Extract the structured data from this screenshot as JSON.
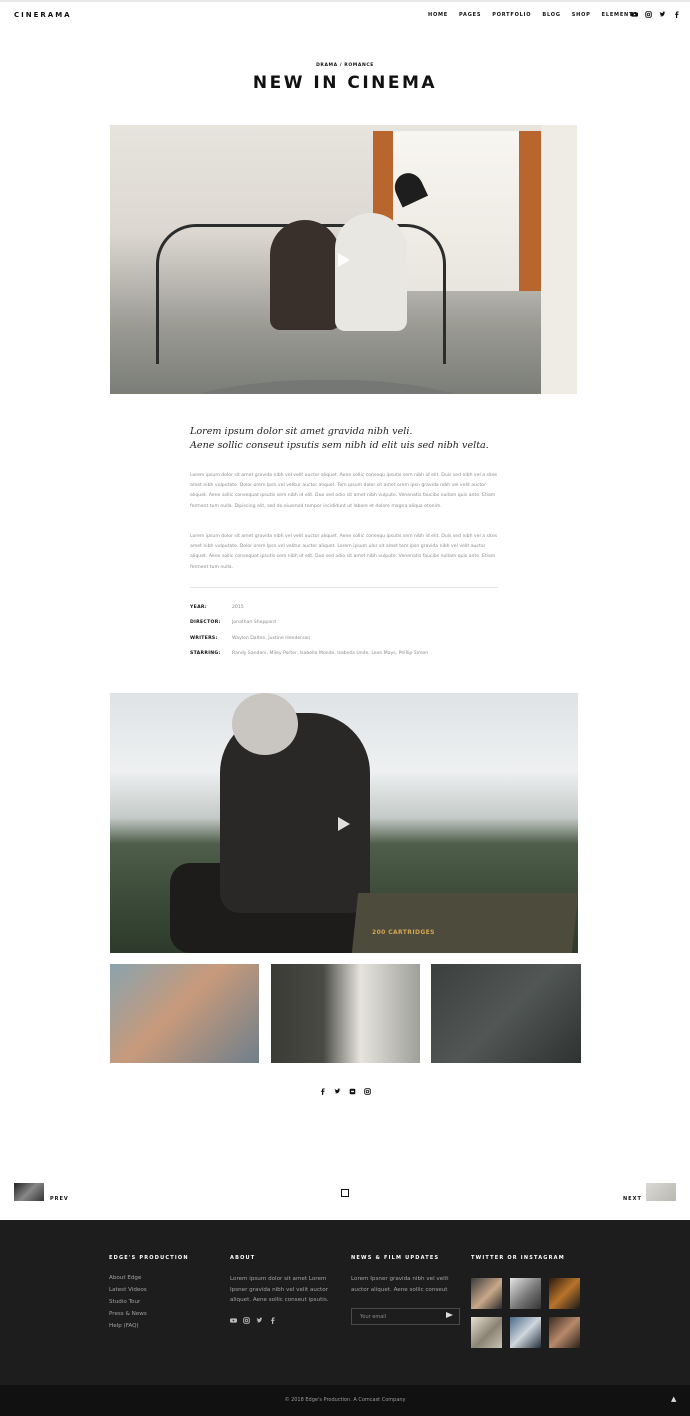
{
  "header": {
    "logo": "CINERAMA",
    "nav": [
      "HOME",
      "PAGES",
      "PORTFOLIO",
      "BLOG",
      "SHOP",
      "ELEMENTS"
    ],
    "social_icons": [
      "youtube-icon",
      "instagram-icon",
      "twitter-icon",
      "facebook-icon"
    ]
  },
  "article": {
    "category": "DRAMA / ROMANCE",
    "title": "NEW IN CINEMA",
    "lead_line1": "Lorem ipsum dolor sit amet gravida nibh veli.",
    "lead_line2": "Aene sollic conseut ipsutis sem nibh id elit uis sed nibh velta.",
    "paragraph1": "Lorem ipsum dolor sit amet gravida nibh vel velit auctor aliquet. Aene sollic consequ ipsutis sem nibh id elit. Duis sed nibh vel a sites amet nibh vulputate. Dolor orem Ipsn vel velitur auctor aliquet. Tem ipsum dolor sit amet orem ipsn gravida nibh vel velit auctor aliquet. Aene sollic consequat ipsutis sem nibh id elit. Duo sed odio sit amet nibh vulpute. Venenatis faucibs nullam quis ante. Etiam ferment tum nulla. Dipiscing elit, sed do eiusmod tempor incididunt ut labore et dolore magna aliqua etenim.",
    "paragraph2": "Lorem ipsum dolor sit amet gravida nibh vel velit auctor aliquet. Aene sollic consequ ipsutis sem nibh id elit. Duis sed nibh vel a sites amet nibh vulputate. Dolor orem Ipsn vel velitur auctor aliquet. Lorem ipsum ulor sit amet tem ipsn gravida nibh vel velit auctor aliquet. Aene sollic consequat ipsutis sem nibh id elit. Duo sed odio sit amet nibh vulpute. Venenatis faucibs nullam quis ante. Etiam ferment tum nulla.",
    "details": [
      {
        "key": "YEAR:",
        "value": "2015"
      },
      {
        "key": "DIRECTOR:",
        "value": "Jonathan Sheppard"
      },
      {
        "key": "WRITERS:",
        "value": "Waylon Dalton, Justine Henderson"
      },
      {
        "key": "STARRING:",
        "value": "Randy Sanders, Miley Porter, Isabella Monde, Isabella Unde, Leon Mays, Phillip Simon"
      }
    ],
    "moto_label": "200 CARTRIDGES",
    "share_icons": [
      "facebook-icon",
      "twitter-icon",
      "tumblr-icon",
      "instagram-icon"
    ]
  },
  "pager": {
    "prev": "PREV",
    "next": "NEXT"
  },
  "footer": {
    "col1_title": "EDGE'S PRODUCTION",
    "col1_links": [
      "About Edge",
      "Latest Videos",
      "Studio Tour",
      "Press & News",
      "Help (FAQ)"
    ],
    "col2_title": "ABOUT",
    "col2_text": "Lorem ipsum dolor sit amet Lorem Ipsner gravida nibh vel velit auctor aliquet. Aene sollic conseut ipsutis.",
    "col3_title": "NEWS & FILM UPDATES",
    "col3_text": "Lorem Ipsner gravida nibh vel velit auctor aliquet. Aene sollic conseut",
    "email_placeholder": "Your email",
    "col4_title": "TWITTER OR INSTAGRAM",
    "copyright": "© 2018 Edge's Production. A Comcast Company"
  }
}
